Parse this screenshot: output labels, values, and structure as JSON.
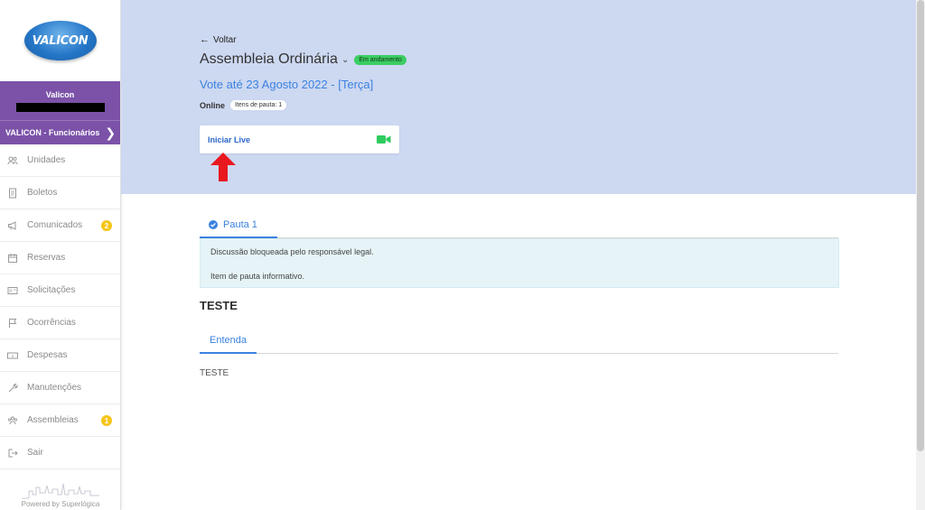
{
  "sidebar": {
    "logo_text": "VALICON",
    "user_name": "Valicon",
    "condo_name": "VALICON - Funcionários",
    "items": [
      {
        "label": "Unidades",
        "icon": "people-icon"
      },
      {
        "label": "Boletos",
        "icon": "document-icon"
      },
      {
        "label": "Comunicados",
        "icon": "megaphone-icon",
        "badge": "2"
      },
      {
        "label": "Reservas",
        "icon": "calendar-icon"
      },
      {
        "label": "Solicitações",
        "icon": "card-icon"
      },
      {
        "label": "Ocorrências",
        "icon": "flag-icon"
      },
      {
        "label": "Despesas",
        "icon": "money-icon"
      },
      {
        "label": "Manutenções",
        "icon": "wrench-icon"
      },
      {
        "label": "Assembleias",
        "icon": "group-icon",
        "badge": "1"
      },
      {
        "label": "Sair",
        "icon": "logout-icon"
      }
    ],
    "powered_by": "Powered by Superlógica"
  },
  "header": {
    "back_label": "Voltar",
    "title": "Assembleia Ordinária",
    "status": "Em andamento",
    "vote_until": "Vote até 23 Agosto 2022 - [Terça]",
    "mode": "Online",
    "items_count": "Itens de pauta: 1",
    "live_label": "Iniciar Live"
  },
  "main": {
    "tab_label": "Pauta 1",
    "info_line1": "Discussão bloqueada pelo responsável legal.",
    "info_line2": "Item de pauta informativo.",
    "section_title": "TESTE",
    "sub_tab_label": "Entenda",
    "body_text": "TESTE"
  },
  "colors": {
    "sidebar_accent": "#7b52a8",
    "header_bg": "#cdd8f1",
    "link_blue": "#3b82e0",
    "status_green": "#3ccd63",
    "badge_yellow": "#f5c518",
    "annotation_red": "#e8181e"
  }
}
